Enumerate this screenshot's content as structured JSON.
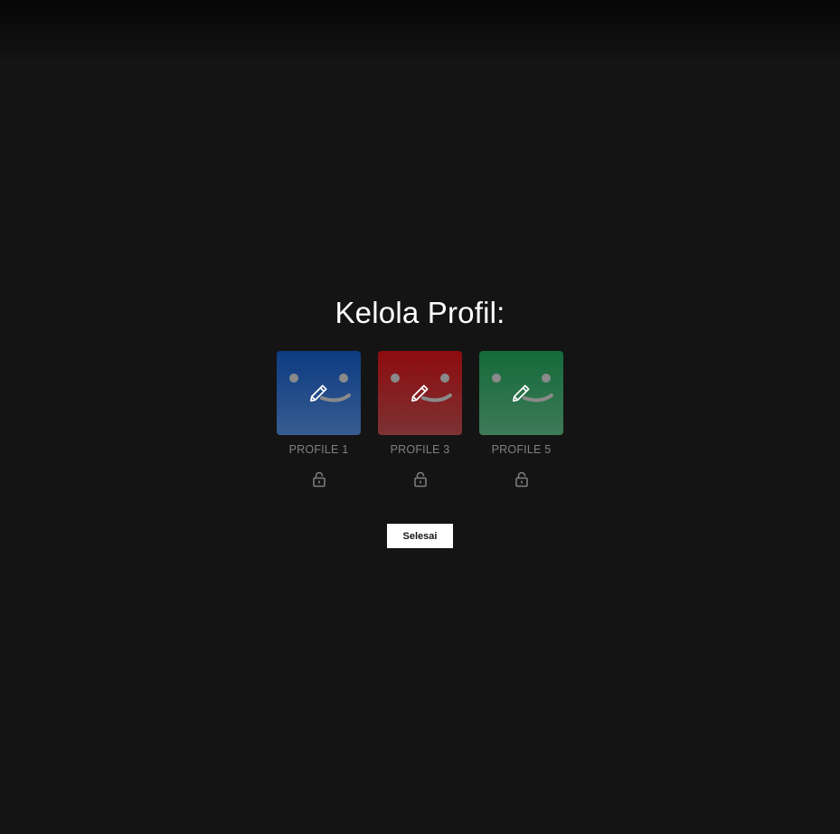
{
  "page": {
    "title": "Kelola Profil:"
  },
  "profiles": [
    {
      "name": "PROFILE 1",
      "color_top": "#0d3b82",
      "color_bottom": "#375c90",
      "edit_icon": "pencil-icon",
      "lock_icon": "lock-icon"
    },
    {
      "name": "PROFILE 3",
      "color_top": "#8e0c0e",
      "color_bottom": "#7c3234",
      "edit_icon": "pencil-icon",
      "lock_icon": "lock-icon"
    },
    {
      "name": "PROFILE 5",
      "color_top": "#146a3a",
      "color_bottom": "#3e7a58",
      "edit_icon": "pencil-icon",
      "lock_icon": "lock-icon"
    }
  ],
  "actions": {
    "done_label": "Selesai"
  },
  "colors": {
    "background": "#141414",
    "text_primary": "#ffffff",
    "text_muted": "#808080"
  }
}
